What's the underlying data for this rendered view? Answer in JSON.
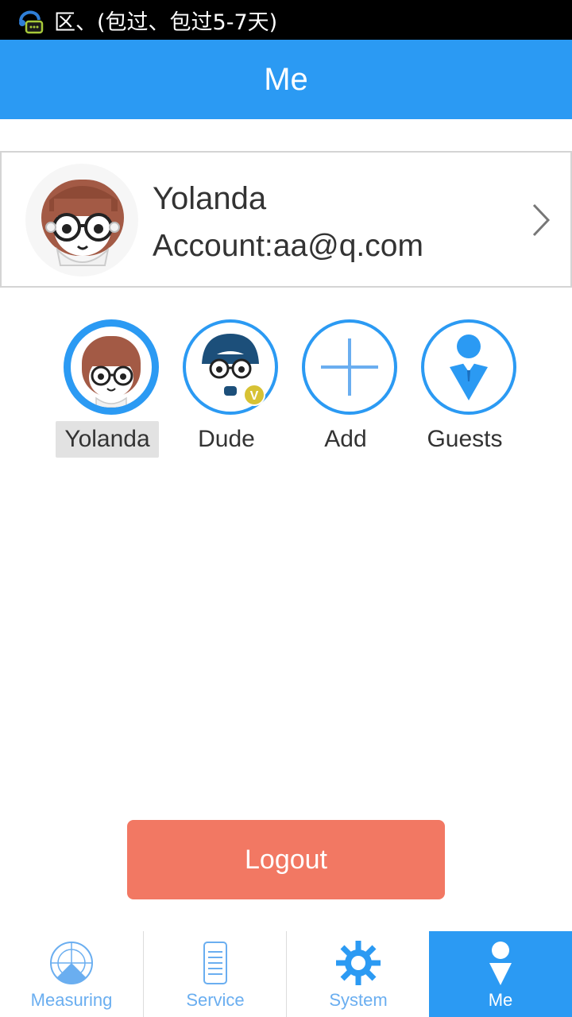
{
  "status_bar": {
    "text": "区、(包过、包过5-7天)"
  },
  "header": {
    "title": "Me"
  },
  "profile": {
    "name": "Yolanda",
    "account": "Account:aa@q.com"
  },
  "members": [
    {
      "label": "Yolanda",
      "selected": true
    },
    {
      "label": "Dude",
      "badge": "V"
    },
    {
      "label": "Add"
    },
    {
      "label": "Guests"
    }
  ],
  "logout_label": "Logout",
  "bottom_nav": [
    {
      "label": "Measuring",
      "icon": "radar-icon"
    },
    {
      "label": "Service",
      "icon": "document-icon"
    },
    {
      "label": "System",
      "icon": "gear-icon"
    },
    {
      "label": "Me",
      "icon": "person-icon",
      "active": true
    }
  ],
  "colors": {
    "primary": "#2b9af3",
    "logout": "#f27863",
    "nav_inactive": "#6aaef0"
  }
}
